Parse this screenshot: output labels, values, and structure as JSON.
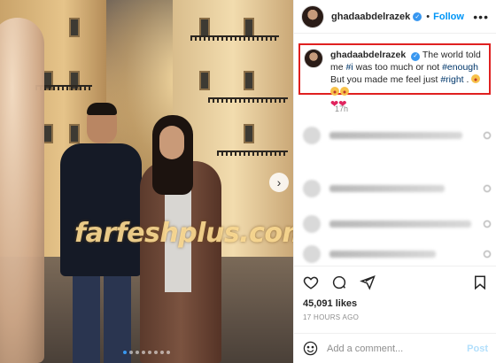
{
  "post": {
    "username": "ghadaabdelrazek",
    "follow_label": "Follow",
    "separator": "•",
    "more_label": "•••",
    "verified_mark": "✓",
    "caption": {
      "username": "ghadaabdelrazek",
      "text_1": " The world told me ",
      "tag_1": "#i",
      "text_2": " was too much or not ",
      "tag_2": "#enough",
      "text_3": " But you made me feel just ",
      "tag_3": "#right",
      "text_4": " . ",
      "hearts": "❤❤"
    },
    "caption_time": "17h",
    "likes": "45,091 likes",
    "time_ago": "17 HOURS AGO",
    "comment_placeholder": "Add a comment...",
    "post_label": "Post",
    "photo_watermark": "farfeshplus.com",
    "next_arrow": "›"
  },
  "icons": {
    "heart": "heart-icon",
    "comment": "comment-icon",
    "share": "share-icon",
    "bookmark": "bookmark-icon",
    "emoji": "emoji-icon",
    "more": "more-options-icon"
  },
  "colors": {
    "accent": "#0095f6",
    "verified": "#3897f0",
    "highlight_border": "#e02020",
    "muted": "#8e8e8e"
  }
}
